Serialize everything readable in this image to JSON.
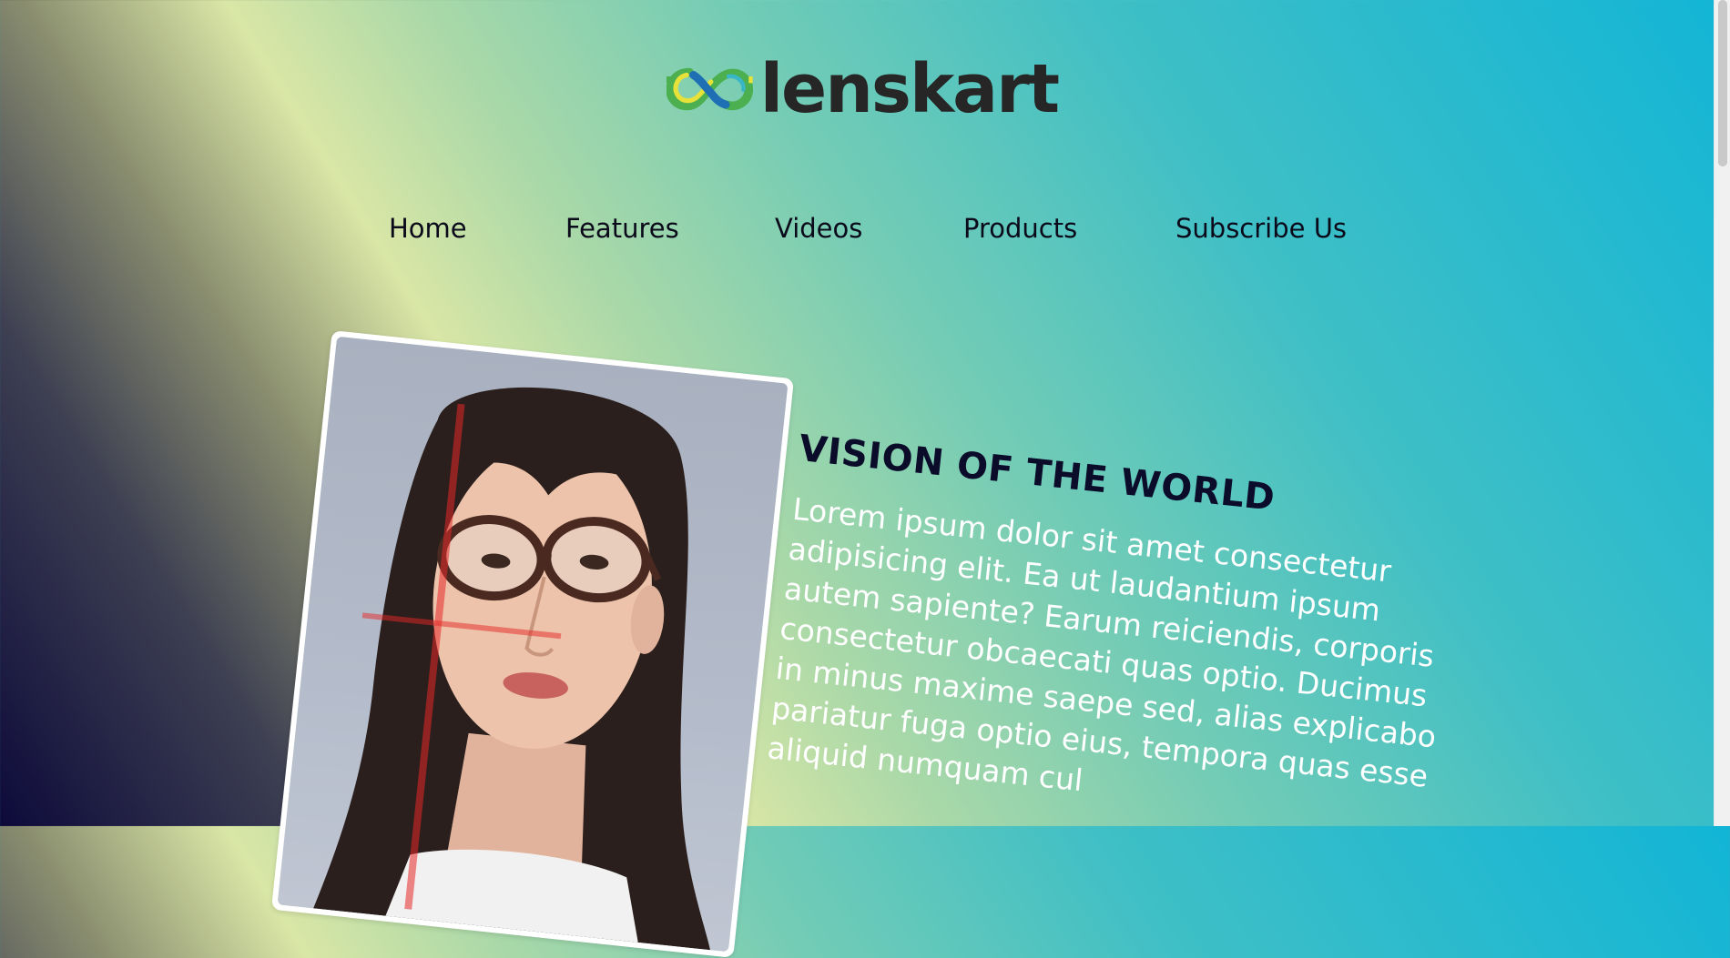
{
  "brand": {
    "name": "lenskart",
    "logo_icon": "infinity-glasses-logo-icon"
  },
  "nav": {
    "items": [
      {
        "label": "Home"
      },
      {
        "label": "Features"
      },
      {
        "label": "Videos"
      },
      {
        "label": "Products"
      },
      {
        "label": "Subscribe Us"
      }
    ]
  },
  "hero": {
    "image_subject": "woman-wearing-glasses-photo",
    "headline": "VISION OF THE WORLD",
    "body": "Lorem ipsum dolor sit amet consectetur adipisicing elit. Ea ut laudantium ipsum autem sapiente? Earum reiciendis, corporis consectetur obcaecati quas optio. Ducimus in minus maxime saepe sed, alias explicabo pariatur fuga optio eius, tempora quas esse aliquid numquam cul"
  },
  "colors": {
    "gradient_dark": "#0d0a3a",
    "gradient_yellow": "#d9e6a6",
    "gradient_cyan": "#12b5d6",
    "headline": "#0b0b2a",
    "body_text": "#ffffff",
    "logo_text": "#262626",
    "logo_green": "#4caf50",
    "logo_yellow": "#e7e23a",
    "logo_blue": "#1f6fb5",
    "logo_teal": "#39b7c6"
  }
}
